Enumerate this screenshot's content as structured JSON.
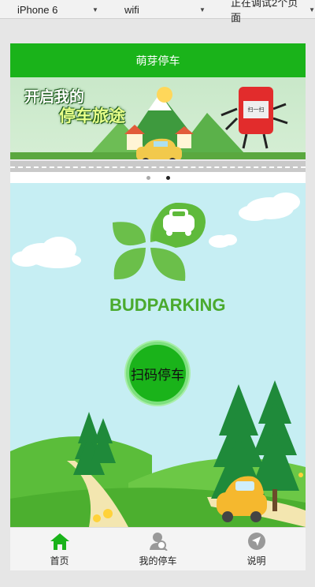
{
  "devtools": {
    "device": "iPhone 6",
    "network": "wifi",
    "debug_status": "正在调试2个页面"
  },
  "navbar": {
    "title": "萌芽停车"
  },
  "banner": {
    "title_line1": "开启我的",
    "title_line2": "停车旅途",
    "sign_text": "扫一扫",
    "indicator_count": 2,
    "active_indicator": 2
  },
  "main": {
    "logo_text": "BUDPARKING",
    "scan_button_label": "扫码停车"
  },
  "tabbar": {
    "items": [
      {
        "label": "首页",
        "icon": "home-icon",
        "active": true
      },
      {
        "label": "我的停车",
        "icon": "my-parking-icon",
        "active": false
      },
      {
        "label": "说明",
        "icon": "compass-icon",
        "active": false
      }
    ]
  },
  "colors": {
    "brand_green": "#1ab31a",
    "sky": "#c6eef3",
    "tab_active": "#1ab31a",
    "tab_inactive": "#999999"
  }
}
